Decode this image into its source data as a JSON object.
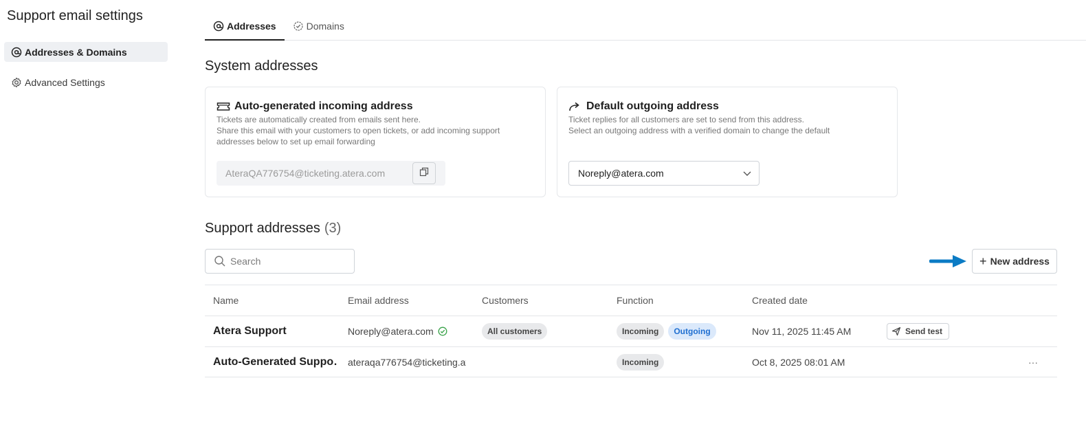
{
  "page": {
    "title": "Support email settings"
  },
  "sidebar": {
    "items": [
      {
        "label": "Addresses & Domains",
        "icon": "at-icon",
        "active": true
      },
      {
        "label": "Advanced Settings",
        "icon": "gear-icon",
        "active": false
      }
    ]
  },
  "tabs": [
    {
      "label": "Addresses",
      "icon": "at-icon",
      "active": true
    },
    {
      "label": "Domains",
      "icon": "check-circle-icon",
      "active": false
    }
  ],
  "system": {
    "title": "System addresses",
    "incoming": {
      "title": "Auto-generated incoming address",
      "desc1": "Tickets are automatically created from emails sent here.",
      "desc2": "Share this email with your customers to open tickets, or add incoming support addresses below to set up email forwarding",
      "value": "AteraQA776754@ticketing.atera.com"
    },
    "outgoing": {
      "title": "Default outgoing address",
      "desc1": "Ticket replies for all customers are set to send from this address.",
      "desc2": "Select an outgoing address with a verified domain to change the default",
      "selected": "Noreply@atera.com"
    }
  },
  "support": {
    "title": "Support addresses",
    "count": "(3)",
    "search_placeholder": "Search",
    "new_button": "New address",
    "columns": {
      "name": "Name",
      "email": "Email address",
      "customers": "Customers",
      "function": "Function",
      "created": "Created date"
    },
    "rows": [
      {
        "name": "Atera Support",
        "email": "Noreply@atera.com",
        "customers": "All customers",
        "func1": "Incoming",
        "func2": "Outgoing",
        "created": "Nov 11, 2025 11:45 AM",
        "action": "Send test"
      },
      {
        "name": "Auto-Generated Suppo…",
        "email": "ateraqa776754@ticketing.at",
        "func1": "Incoming",
        "created": "Oct 8, 2025 08:01 AM",
        "more": "···"
      }
    ]
  },
  "colors": {
    "accent_blue": "#1f6fd1",
    "arrow_blue": "#0b7bc4",
    "verified_green": "#3aa34a",
    "active_bg": "#eef0f3"
  }
}
